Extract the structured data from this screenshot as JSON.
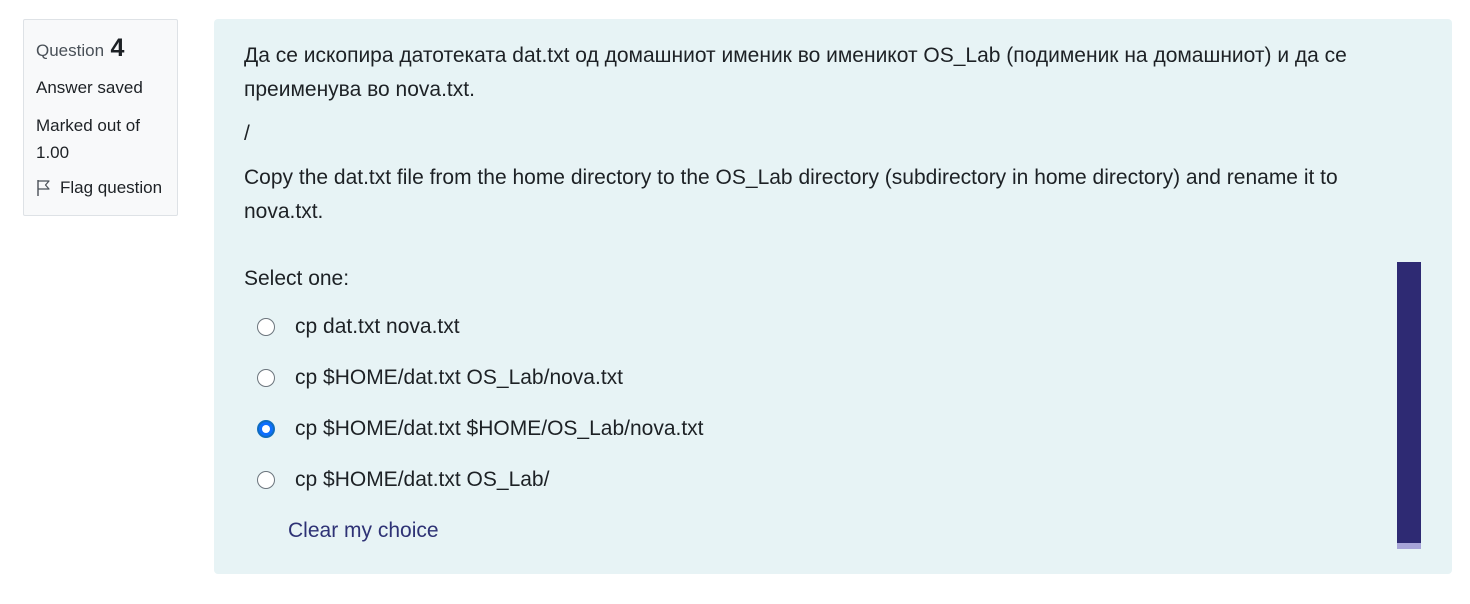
{
  "info": {
    "question_label": "Question",
    "question_number": "4",
    "state": "Answer saved",
    "grade": "Marked out of 1.00",
    "flag_label": "Flag question"
  },
  "question": {
    "text_mk": "Да се ископира датотеката dat.txt од домашниот именик во именикот OS_Lab (подименик на домашниот) и да се преименува во nova.txt.",
    "separator": "/",
    "text_en": "Copy the dat.txt file from the home directory to the OS_Lab directory (subdirectory in home directory) and rename it to nova.txt.",
    "prompt": "Select one:",
    "options": [
      {
        "label": "cp dat.txt nova.txt",
        "selected": false
      },
      {
        "label": "cp $HOME/dat.txt OS_Lab/nova.txt",
        "selected": false
      },
      {
        "label": "cp $HOME/dat.txt $HOME/OS_Lab/nova.txt",
        "selected": true
      },
      {
        "label": "cp $HOME/dat.txt OS_Lab/",
        "selected": false
      }
    ],
    "clear_label": "Clear my choice"
  },
  "colors": {
    "content_bg": "#e7f3f5",
    "link": "#2e3275",
    "radio_checked": "#0d6efd",
    "scroll_thumb": "#2e2a73",
    "scroll_track": "#a7a4d8"
  }
}
